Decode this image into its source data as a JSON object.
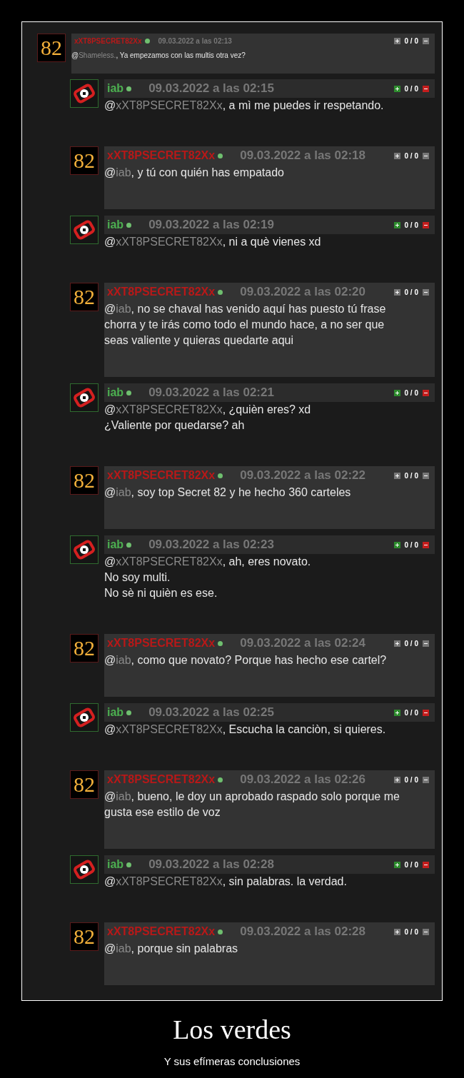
{
  "first_comment": {
    "avatar_text": "82",
    "username": "xXT8PSECRET82Xx",
    "online": true,
    "date": "09.03.2022 a las 02:13",
    "votes": "0 / 0",
    "at": "@",
    "mention": "Shameless.",
    "lines": [
      ", Ya empezamos con las multis otra vez?"
    ]
  },
  "replies": [
    {
      "kind": "plain",
      "username": "iab",
      "online": true,
      "date": "09.03.2022 a las 02:15",
      "votes": "0 / 0",
      "at": "@",
      "mention": "xXT8PSECRET82Xx",
      "lines": [
        ", a mì me puedes ir respetando."
      ]
    },
    {
      "kind": "boxed",
      "avatar_text": "82",
      "username": "xXT8PSECRET82Xx",
      "online": true,
      "date": "09.03.2022 a las 02:18",
      "votes": "0 / 0",
      "at": "@",
      "mention": "iab",
      "lines": [
        ", y tú con quién has empatado"
      ]
    },
    {
      "kind": "plain",
      "username": "iab",
      "online": true,
      "date": "09.03.2022 a las 02:19",
      "votes": "0 / 0",
      "at": "@",
      "mention": "xXT8PSECRET82Xx",
      "lines": [
        ", ni a què vienes xd"
      ]
    },
    {
      "kind": "boxed",
      "avatar_text": "82",
      "username": "xXT8PSECRET82Xx",
      "online": true,
      "date": "09.03.2022 a las 02:20",
      "votes": "0 / 0",
      "at": "@",
      "mention": "iab",
      "lines": [
        ", no se chaval has venido aquí has puesto tú frase",
        "chorra y te irás como todo el mundo hace, a no ser que",
        "seas valiente y quieras quedarte aqui"
      ]
    },
    {
      "kind": "plain",
      "username": "iab",
      "online": true,
      "date": "09.03.2022 a las 02:21",
      "votes": "0 / 0",
      "at": "@",
      "mention": "xXT8PSECRET82Xx",
      "lines": [
        ", ¿quièn eres? xd",
        "¿Valiente por quedarse? ah"
      ]
    },
    {
      "kind": "boxed",
      "avatar_text": "82",
      "username": "xXT8PSECRET82Xx",
      "online": true,
      "date": "09.03.2022 a las 02:22",
      "votes": "0 / 0",
      "at": "@",
      "mention": "iab",
      "lines": [
        ", soy top Secret 82 y he hecho 360 carteles"
      ]
    },
    {
      "kind": "plain",
      "username": "iab",
      "online": true,
      "date": "09.03.2022 a las 02:23",
      "votes": "0 / 0",
      "at": "@",
      "mention": "xXT8PSECRET82Xx",
      "lines": [
        ", ah, eres novato.",
        "No soy multi.",
        "No sè ni quièn es ese."
      ]
    },
    {
      "kind": "boxed",
      "avatar_text": "82",
      "username": "xXT8PSECRET82Xx",
      "online": true,
      "date": "09.03.2022 a las 02:24",
      "votes": "0 / 0",
      "at": "@",
      "mention": "iab",
      "lines": [
        ", como que novato? Porque has hecho ese cartel?"
      ]
    },
    {
      "kind": "plain",
      "username": "iab",
      "online": true,
      "date": "09.03.2022 a las 02:25",
      "votes": "0 / 0",
      "at": "@",
      "mention": "xXT8PSECRET82Xx",
      "lines": [
        ", Escucha la canciòn, si quieres."
      ]
    },
    {
      "kind": "boxed",
      "avatar_text": "82",
      "username": "xXT8PSECRET82Xx",
      "online": true,
      "date": "09.03.2022 a las 02:26",
      "votes": "0 / 0",
      "at": "@",
      "mention": "iab",
      "lines": [
        ", bueno, le doy un aprobado raspado solo porque me",
        "gusta ese estilo de voz"
      ]
    },
    {
      "kind": "plain",
      "username": "iab",
      "online": true,
      "date": "09.03.2022 a las 02:28",
      "votes": "0 / 0",
      "at": "@",
      "mention": "xXT8PSECRET82Xx",
      "lines": [
        ", sin palabras. la verdad."
      ]
    },
    {
      "kind": "boxed",
      "avatar_text": "82",
      "username": "xXT8PSECRET82Xx",
      "online": true,
      "date": "09.03.2022 a las 02:28",
      "votes": "0 / 0",
      "at": "@",
      "mention": "iab",
      "lines": [
        ", porque sin palabras"
      ]
    }
  ],
  "poster": {
    "title": "Los verdes",
    "subtitle": "Y sus efímeras conclusiones"
  }
}
